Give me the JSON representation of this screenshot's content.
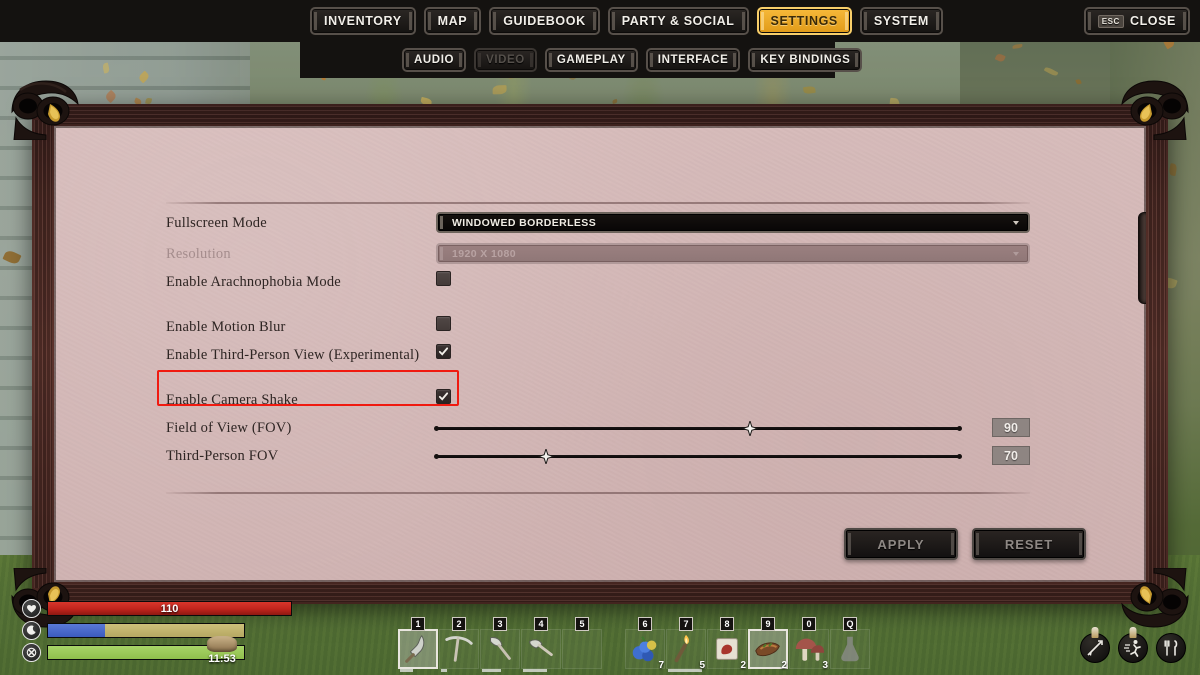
{
  "nav": {
    "main_tabs": [
      {
        "label": "INVENTORY",
        "active": false
      },
      {
        "label": "MAP",
        "active": false
      },
      {
        "label": "GUIDEBOOK",
        "active": false
      },
      {
        "label": "PARTY & SOCIAL",
        "active": false
      },
      {
        "label": "SETTINGS",
        "active": true
      },
      {
        "label": "SYSTEM",
        "active": false
      }
    ],
    "sub_tabs": [
      {
        "label": "AUDIO",
        "state": "normal"
      },
      {
        "label": "VIDEO",
        "state": "disabled"
      },
      {
        "label": "GAMEPLAY",
        "state": "normal"
      },
      {
        "label": "INTERFACE",
        "state": "normal"
      },
      {
        "label": "KEY BINDINGS",
        "state": "normal"
      }
    ],
    "close": {
      "key": "ESC",
      "label": "CLOSE"
    }
  },
  "settings": {
    "fullscreen_mode": {
      "label": "Fullscreen Mode",
      "value": "WINDOWED BORDERLESS"
    },
    "resolution": {
      "label": "Resolution",
      "value": "1920 X 1080",
      "disabled": true
    },
    "arachnophobia": {
      "label": "Enable Arachnophobia Mode",
      "checked": false
    },
    "motion_blur": {
      "label": "Enable Motion Blur",
      "checked": false
    },
    "third_person": {
      "label": "Enable Third-Person View (Experimental)",
      "checked": true,
      "highlighted": true
    },
    "camera_shake": {
      "label": "Enable Camera Shake",
      "checked": true
    },
    "fov": {
      "label": "Field of View (FOV)",
      "value": "90",
      "percent": 60
    },
    "third_person_fov": {
      "label": "Third-Person FOV",
      "value": "70",
      "percent": 21
    }
  },
  "actions": {
    "apply": "APPLY",
    "reset": "RESET"
  },
  "hud": {
    "health": {
      "icon": "heart-icon",
      "value": "110",
      "percent": 100,
      "color": "#c0241c"
    },
    "stamina": {
      "icon": "moon-icon",
      "value": "",
      "percent": 29,
      "color": "#3b5bbd"
    },
    "hunger": {
      "icon": "hunger-icon",
      "value": "",
      "percent": 100,
      "color": "#89c martin"
    },
    "clock": {
      "time": "11:53",
      "icon": "sun-icon"
    },
    "hotbar_left": [
      {
        "key": "1",
        "item": "spear-icon",
        "qty": "",
        "selected": true,
        "durability": 42
      },
      {
        "key": "2",
        "item": "pickaxe-icon",
        "qty": "",
        "selected": false,
        "durability": 26
      },
      {
        "key": "3",
        "item": "axe-icon",
        "qty": "",
        "selected": false,
        "durability": 58
      },
      {
        "key": "4",
        "item": "hatchet-icon",
        "qty": "",
        "selected": false,
        "durability": 70
      },
      {
        "key": "5",
        "item": "",
        "qty": "",
        "selected": false,
        "durability": 0
      }
    ],
    "hotbar_right": [
      {
        "key": "6",
        "item": "berries-icon",
        "qty": "7",
        "selected": false,
        "durability": 0
      },
      {
        "key": "7",
        "item": "torch-icon",
        "qty": "5",
        "selected": false,
        "durability": 95
      },
      {
        "key": "8",
        "item": "meat-icon",
        "qty": "2",
        "selected": false,
        "durability": 0
      },
      {
        "key": "9",
        "item": "cooked-fish-icon",
        "qty": "2",
        "selected": true,
        "durability": 0
      },
      {
        "key": "0",
        "item": "mushroom-icon",
        "qty": "3",
        "selected": false,
        "durability": 0
      },
      {
        "key": "Q",
        "item": "flask-icon",
        "qty": "",
        "selected": false,
        "durability": 0
      }
    ],
    "right_icons": [
      {
        "name": "bow-icon"
      },
      {
        "name": "sprint-icon"
      },
      {
        "name": "eat-icon"
      }
    ]
  },
  "colors": {
    "accent": "#f0a81e",
    "panel": "#d4b5b5",
    "frame": "#4e2b25",
    "highlight": "#f01a10",
    "health": "#c0241c",
    "stamina": "#3b5bbd",
    "hunger": "#8fbf4c"
  }
}
